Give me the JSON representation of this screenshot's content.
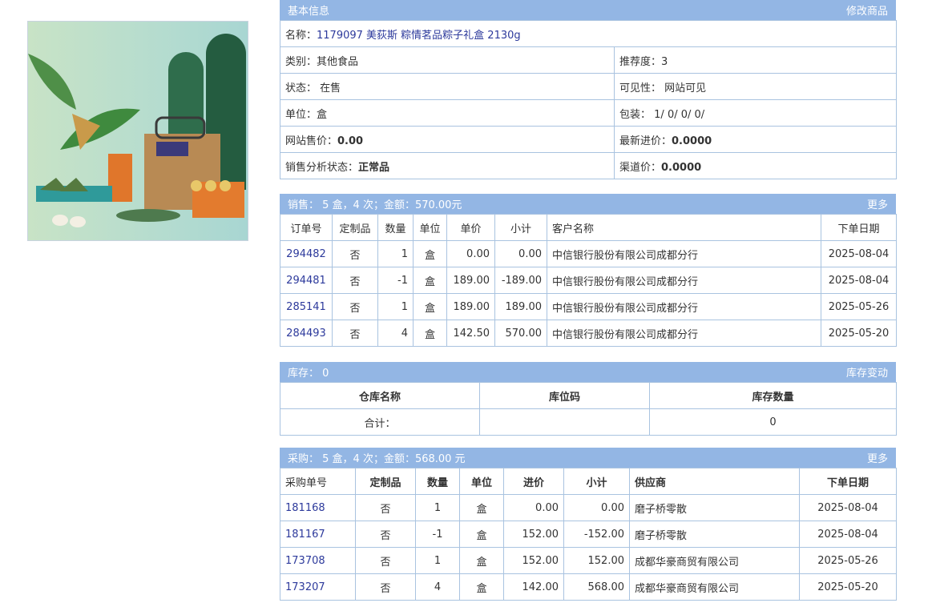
{
  "basic": {
    "header": "基本信息",
    "edit_link": "修改商品",
    "name_label": "名称：",
    "name_value": "1179097 美荻斯 粽情茗品粽子礼盒 2130g",
    "category_label": "类别：",
    "category_value": "其他食品",
    "recommend_label": "推荐度：",
    "recommend_value": "3",
    "status_label": "状态：",
    "status_value": "在售",
    "visibility_label": "可见性：",
    "visibility_value": "网站可见",
    "unit_label": "单位：",
    "unit_value": "盒",
    "package_label": "包装：",
    "package_value": "1/ 0/ 0/ 0/",
    "site_price_label": "网站售价：",
    "site_price_value": "0.00",
    "latest_cost_label": "最新进价：",
    "latest_cost_value": "0.0000",
    "sales_status_label": "销售分析状态：",
    "sales_status_value": "正常品",
    "channel_price_label": "渠道价：",
    "channel_price_value": "0.0000"
  },
  "sales": {
    "header": "销售：  5 盒，4 次；金额：570.00元",
    "more_link": "更多",
    "columns": [
      "订单号",
      "定制品",
      "数量",
      "单位",
      "单价",
      "小计",
      "客户名称",
      "下单日期"
    ],
    "rows": [
      {
        "order": "294482",
        "custom": "否",
        "qty": "1",
        "unit": "盒",
        "price": "0.00",
        "subtotal": "0.00",
        "customer": "中信银行股份有限公司成都分行",
        "date": "2025-08-04"
      },
      {
        "order": "294481",
        "custom": "否",
        "qty": "-1",
        "unit": "盒",
        "price": "189.00",
        "subtotal": "-189.00",
        "customer": "中信银行股份有限公司成都分行",
        "date": "2025-08-04"
      },
      {
        "order": "285141",
        "custom": "否",
        "qty": "1",
        "unit": "盒",
        "price": "189.00",
        "subtotal": "189.00",
        "customer": "中信银行股份有限公司成都分行",
        "date": "2025-05-26"
      },
      {
        "order": "284493",
        "custom": "否",
        "qty": "4",
        "unit": "盒",
        "price": "142.50",
        "subtotal": "570.00",
        "customer": "中信银行股份有限公司成都分行",
        "date": "2025-05-20"
      }
    ]
  },
  "stock": {
    "header": "库存：  0",
    "change_link": "库存变动",
    "columns": [
      "仓库名称",
      "库位码",
      "库存数量"
    ],
    "total_label": "合计：",
    "total_location": "",
    "total_value": "0"
  },
  "purchase": {
    "header": "采购：  5 盒，4 次；金额：568.00 元",
    "more_link": "更多",
    "columns": [
      "采购单号",
      "定制品",
      "数量",
      "单位",
      "进价",
      "小计",
      "供应商",
      "下单日期"
    ],
    "rows": [
      {
        "order": "181168",
        "custom": "否",
        "qty": "1",
        "unit": "盒",
        "price": "0.00",
        "subtotal": "0.00",
        "supplier": "磨子桥零散",
        "date": "2025-08-04"
      },
      {
        "order": "181167",
        "custom": "否",
        "qty": "-1",
        "unit": "盒",
        "price": "152.00",
        "subtotal": "-152.00",
        "supplier": "磨子桥零散",
        "date": "2025-08-04"
      },
      {
        "order": "173708",
        "custom": "否",
        "qty": "1",
        "unit": "盒",
        "price": "152.00",
        "subtotal": "152.00",
        "supplier": "成都华豪商贸有限公司",
        "date": "2025-05-26"
      },
      {
        "order": "173207",
        "custom": "否",
        "qty": "4",
        "unit": "盒",
        "price": "142.00",
        "subtotal": "568.00",
        "supplier": "成都华豪商贸有限公司",
        "date": "2025-05-20"
      }
    ]
  }
}
